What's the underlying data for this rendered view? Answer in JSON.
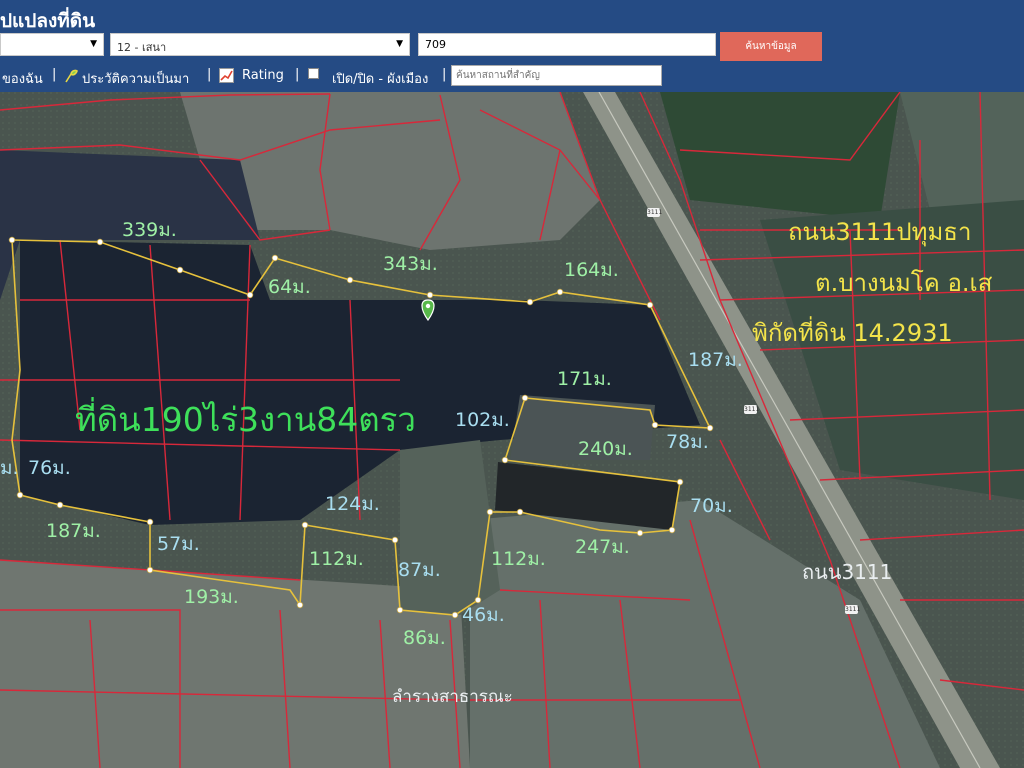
{
  "header": {
    "title": "ปแปลงที่ดิน",
    "province_select": "",
    "district_select": "12 - เสนา",
    "parcel_input": "709",
    "search_button": "ค้นหาข้อมูล"
  },
  "toolbar": {
    "my_land": "ของฉัน",
    "history": "ประวัติความเป็นมา",
    "rating": "Rating",
    "layer_toggle": "เปิด/ปิด - ผังเมือง",
    "search_placeholder": "ค้นหาสถานที่สำคัญ",
    "separator": "|"
  },
  "map": {
    "icons": [
      "history-leaf-icon",
      "rating-chart-icon",
      "checkbox-icon",
      "location-pin-icon"
    ],
    "colors": {
      "parcel_lines": "#d8283a",
      "boundary": "#e6c13c",
      "area_label": "#3ee05a",
      "info_label": "#f3e34a",
      "distance_green": "#9ff0a6",
      "distance_blue": "#a9def0"
    },
    "road_shield": "3111",
    "area_label": "ที่ดิน190ไร่3งาน84ตรว",
    "info_line1": "ถนน3111ปทุมธา",
    "info_line2": "ต.บางนมโค อ.เส",
    "info_line3": "พิกัดที่ดิน 14.2931",
    "road_label": "ถนน3111",
    "canal_label": "ลำรางสาธารณะ",
    "measurements": {
      "m339": "339ม.",
      "m343": "343ม.",
      "m64": "64ม.",
      "m164": "164ม.",
      "m187a": "187ม.",
      "m171": "171ม.",
      "m102": "102ม.",
      "m78": "78ม.",
      "m240": "240ม.",
      "m76": "76ม.",
      "m124": "124ม.",
      "m70": "70ม.",
      "m187b": "187ม.",
      "m57": "57ม.",
      "m112a": "112ม.",
      "m87": "87ม.",
      "m112b": "112ม.",
      "m247": "247ม.",
      "m193": "193ม.",
      "m86": "86ม.",
      "m46": "46ม.",
      "m_left": "ม."
    }
  }
}
